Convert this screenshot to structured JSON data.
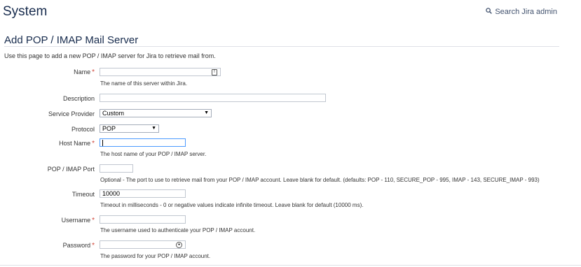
{
  "header": {
    "title": "System",
    "search_label": "Search Jira admin"
  },
  "section": {
    "title": "Add POP / IMAP Mail Server",
    "intro": "Use this page to add a new POP / IMAP server for Jira to retrieve mail from."
  },
  "form": {
    "name": {
      "label": "Name",
      "required": "*",
      "value": "",
      "help": "The name of this server within Jira."
    },
    "description": {
      "label": "Description",
      "value": ""
    },
    "service_provider": {
      "label": "Service Provider",
      "selected": "Custom"
    },
    "protocol": {
      "label": "Protocol",
      "selected": "POP"
    },
    "host_name": {
      "label": "Host Name",
      "required": "*",
      "value": "",
      "help": "The host name of your POP / IMAP server."
    },
    "port": {
      "label": "POP / IMAP Port",
      "value": "",
      "help": "Optional - The port to use to retrieve mail from your POP / IMAP account. Leave blank for default. (defaults: POP - 110, SECURE_POP - 995, IMAP - 143, SECURE_IMAP - 993)"
    },
    "timeout": {
      "label": "Timeout",
      "value": "10000",
      "help": "Timeout in milliseconds - 0 or negative values indicate infinite timeout. Leave blank for default (10000 ms)."
    },
    "username": {
      "label": "Username",
      "required": "*",
      "value": "",
      "help": "The username used to authenticate your POP / IMAP account."
    },
    "password": {
      "label": "Password",
      "required": "*",
      "value": "",
      "help": "The password for your POP / IMAP account."
    }
  },
  "icons": {
    "search": "search-icon",
    "dropdown": "chevron-down-icon",
    "autofill": "autofill-icon",
    "password_manager": "password-manager-icon"
  },
  "colors": {
    "required": "#d04437",
    "title": "#172b4d",
    "border": "#c1c7d0"
  }
}
